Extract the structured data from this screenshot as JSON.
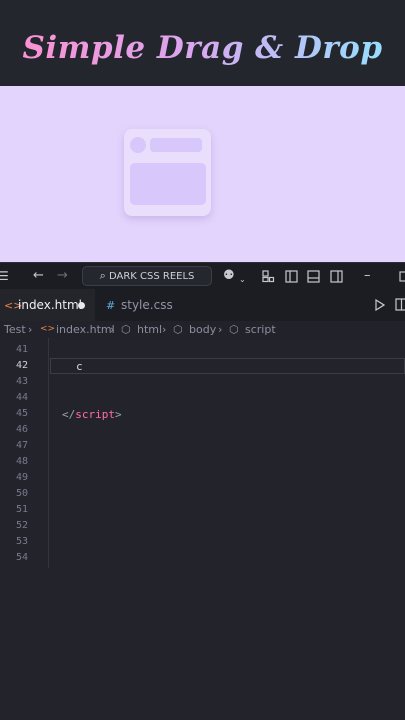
{
  "title": "Simple Drag & Drop",
  "toolbar": {
    "search_label": "DARK CSS REELS"
  },
  "tabs": [
    {
      "label": "index.html"
    },
    {
      "label": "style.css"
    }
  ],
  "breadcrumb": [
    "Test",
    "index.html",
    "html",
    "body",
    "script"
  ],
  "editor": {
    "line_numbers": [
      "41",
      "42",
      "43",
      "44",
      "45",
      "46",
      "47",
      "48",
      "49",
      "50",
      "51",
      "52",
      "53",
      "54"
    ],
    "current_line_text": "c",
    "closing_tag_open": "</",
    "closing_tag_name": "script",
    "closing_tag_close": ">"
  },
  "colors": {
    "preview_bg": "#e3d4fd",
    "tag_color": "#ff6ea8",
    "html_tab_icon": "#e8804a",
    "css_tab_icon": "#5ab0e0"
  }
}
